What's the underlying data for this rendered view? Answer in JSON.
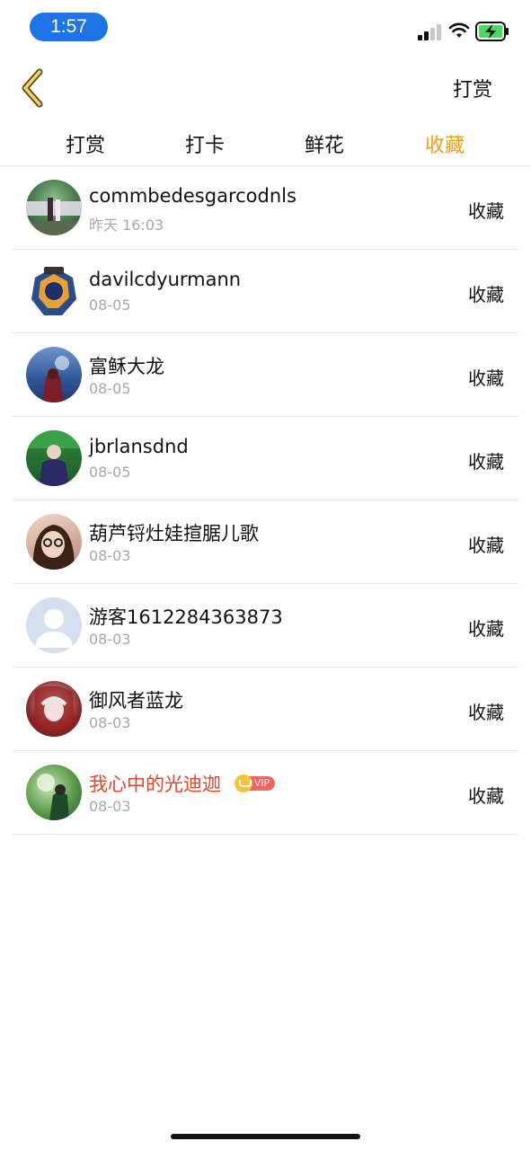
{
  "status_bar": {
    "time": "1:57"
  },
  "nav": {
    "action_label": "打赏"
  },
  "tabs": [
    {
      "label": "打赏",
      "active": false
    },
    {
      "label": "打卡",
      "active": false
    },
    {
      "label": "鲜花",
      "active": false
    },
    {
      "label": "收藏",
      "active": true
    }
  ],
  "colors": {
    "accent": "#f0a020",
    "vip_name": "#e0462e",
    "time_pill": "#1d74e7"
  },
  "rows": [
    {
      "name": "commbedesgarcodnls",
      "date": "昨天 16:03",
      "action": "收藏",
      "avatar": "green-photo"
    },
    {
      "name": "davilcdyurmann",
      "date": "08-05",
      "action": "收藏",
      "avatar": "blue-emblem"
    },
    {
      "name": "富稣大龙",
      "date": "08-05",
      "action": "收藏",
      "avatar": "blue-sky-figure"
    },
    {
      "name": "jbrlansdnd",
      "date": "08-05",
      "action": "收藏",
      "avatar": "green-figure"
    },
    {
      "name": "葫芦锊灶娃揎腒儿歌",
      "date": "08-03",
      "action": "收藏",
      "avatar": "girl-glasses"
    },
    {
      "name": "游客1612284363873",
      "date": "08-03",
      "action": "收藏",
      "avatar": "default-user"
    },
    {
      "name": "御风者蓝龙",
      "date": "08-03",
      "action": "收藏",
      "avatar": "red-anime"
    },
    {
      "name": "我心中的光迪迦",
      "date": "08-03",
      "action": "收藏",
      "avatar": "green-anime",
      "vip": true,
      "vip_label": "VIP"
    }
  ]
}
